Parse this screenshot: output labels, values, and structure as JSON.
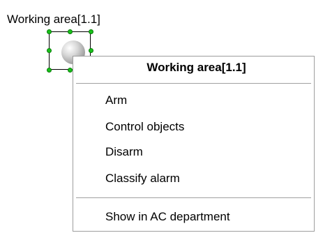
{
  "canvas": {
    "object_label": "Working area[1.1]"
  },
  "context_menu": {
    "header": "Working area[1.1]",
    "items": [
      {
        "label": "Arm"
      },
      {
        "label": "Control objects"
      },
      {
        "label": "Disarm"
      },
      {
        "label": "Classify alarm"
      },
      {
        "label": "Show in AC department"
      }
    ]
  },
  "colors": {
    "handle": "#18c21a",
    "menu_border": "#9d9d9d",
    "separator": "#a0a0a0"
  }
}
